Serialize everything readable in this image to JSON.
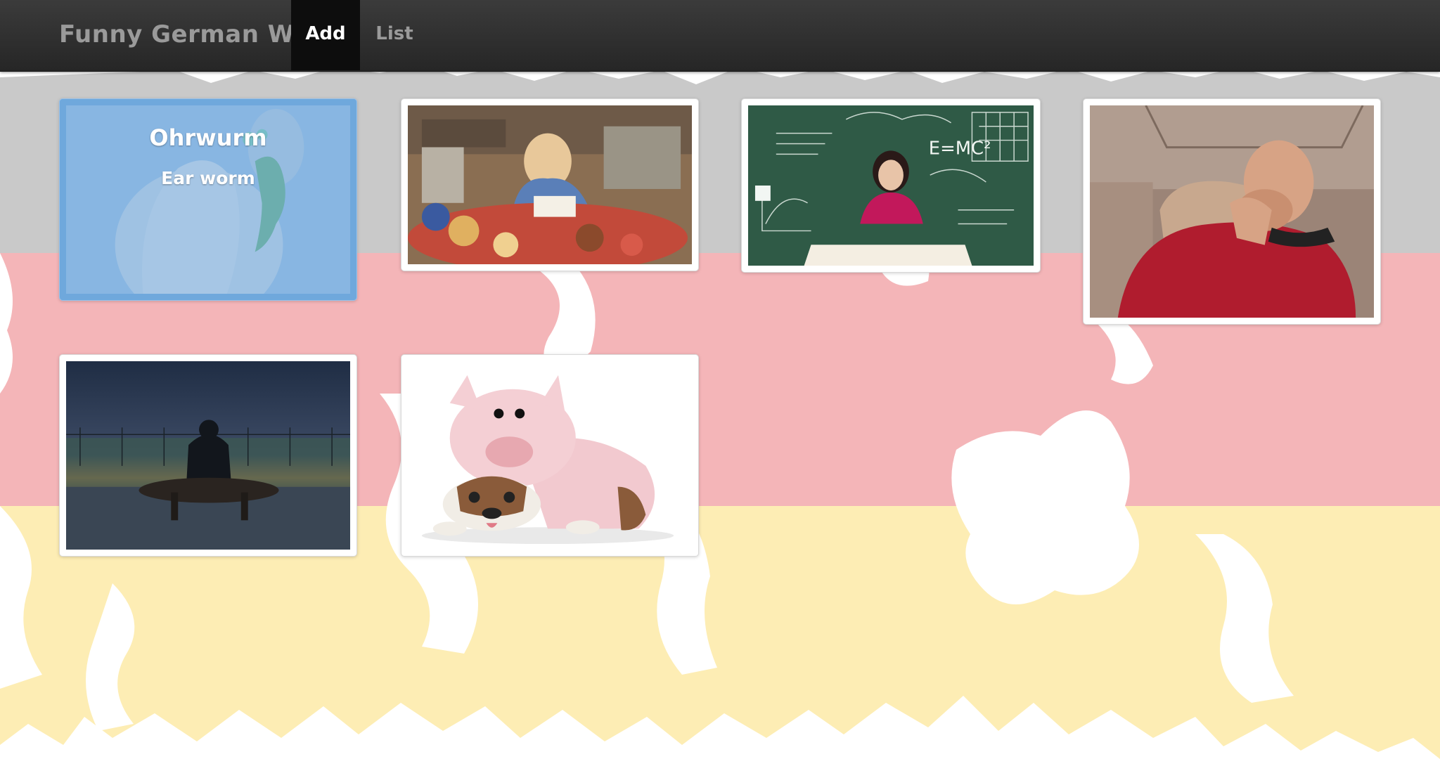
{
  "navbar": {
    "brand": "Funny German Words",
    "items": [
      {
        "label": "Add",
        "active": true
      },
      {
        "label": "List",
        "active": false
      }
    ]
  },
  "background": {
    "image": "germany-map-flag",
    "colors": {
      "black_band": "#c9c9c9",
      "red_band": "#f4b5b8",
      "gold_band": "#fdedb4"
    }
  },
  "cards": [
    {
      "image": "hand-with-worm-ear-image",
      "german": "Ohrwurm",
      "english": "Ear worm",
      "selected": true
    },
    {
      "image": "woman-eating-food-pile-image",
      "selected": false
    },
    {
      "image": "student-at-chalkboard-image",
      "selected": false
    },
    {
      "image": "captain-facepalm-image",
      "selected": false
    },
    {
      "image": "man-on-bench-at-dusk-image",
      "selected": false
    },
    {
      "image": "bulldog-in-pig-costume-image",
      "selected": false
    }
  ],
  "accent": "#6fa8dc"
}
